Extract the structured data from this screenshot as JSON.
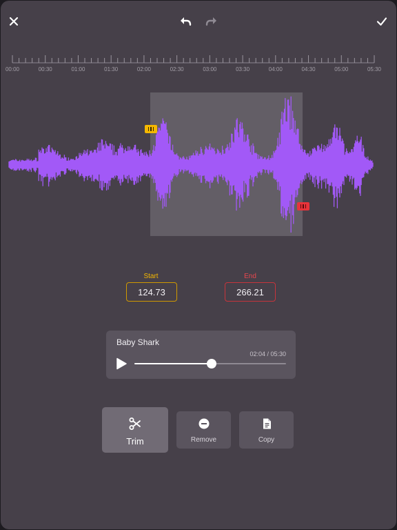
{
  "toolbar": {
    "close_icon": "close-icon",
    "undo_icon": "undo-icon",
    "redo_icon": "redo-icon",
    "confirm_icon": "checkmark-icon"
  },
  "timeline": {
    "labels": [
      "00:00",
      "00:30",
      "01:00",
      "01:30",
      "02:00",
      "02:30",
      "03:00",
      "03:30",
      "04:00",
      "04:30",
      "05:00",
      "05:30"
    ]
  },
  "waveform": {
    "color": "#a259f7",
    "selection_start_fraction": 0.3778,
    "selection_end_fraction": 0.8037
  },
  "fields": {
    "start_label": "Start",
    "start_value": "124.73",
    "end_label": "End",
    "end_value": "266.21",
    "start_color": "#f5b800",
    "end_color": "#e8333a"
  },
  "player": {
    "title": "Baby Shark",
    "time": "02:04 / 05:30",
    "progress": 0.51
  },
  "actions": {
    "trim": "Trim",
    "remove": "Remove",
    "copy": "Copy"
  }
}
